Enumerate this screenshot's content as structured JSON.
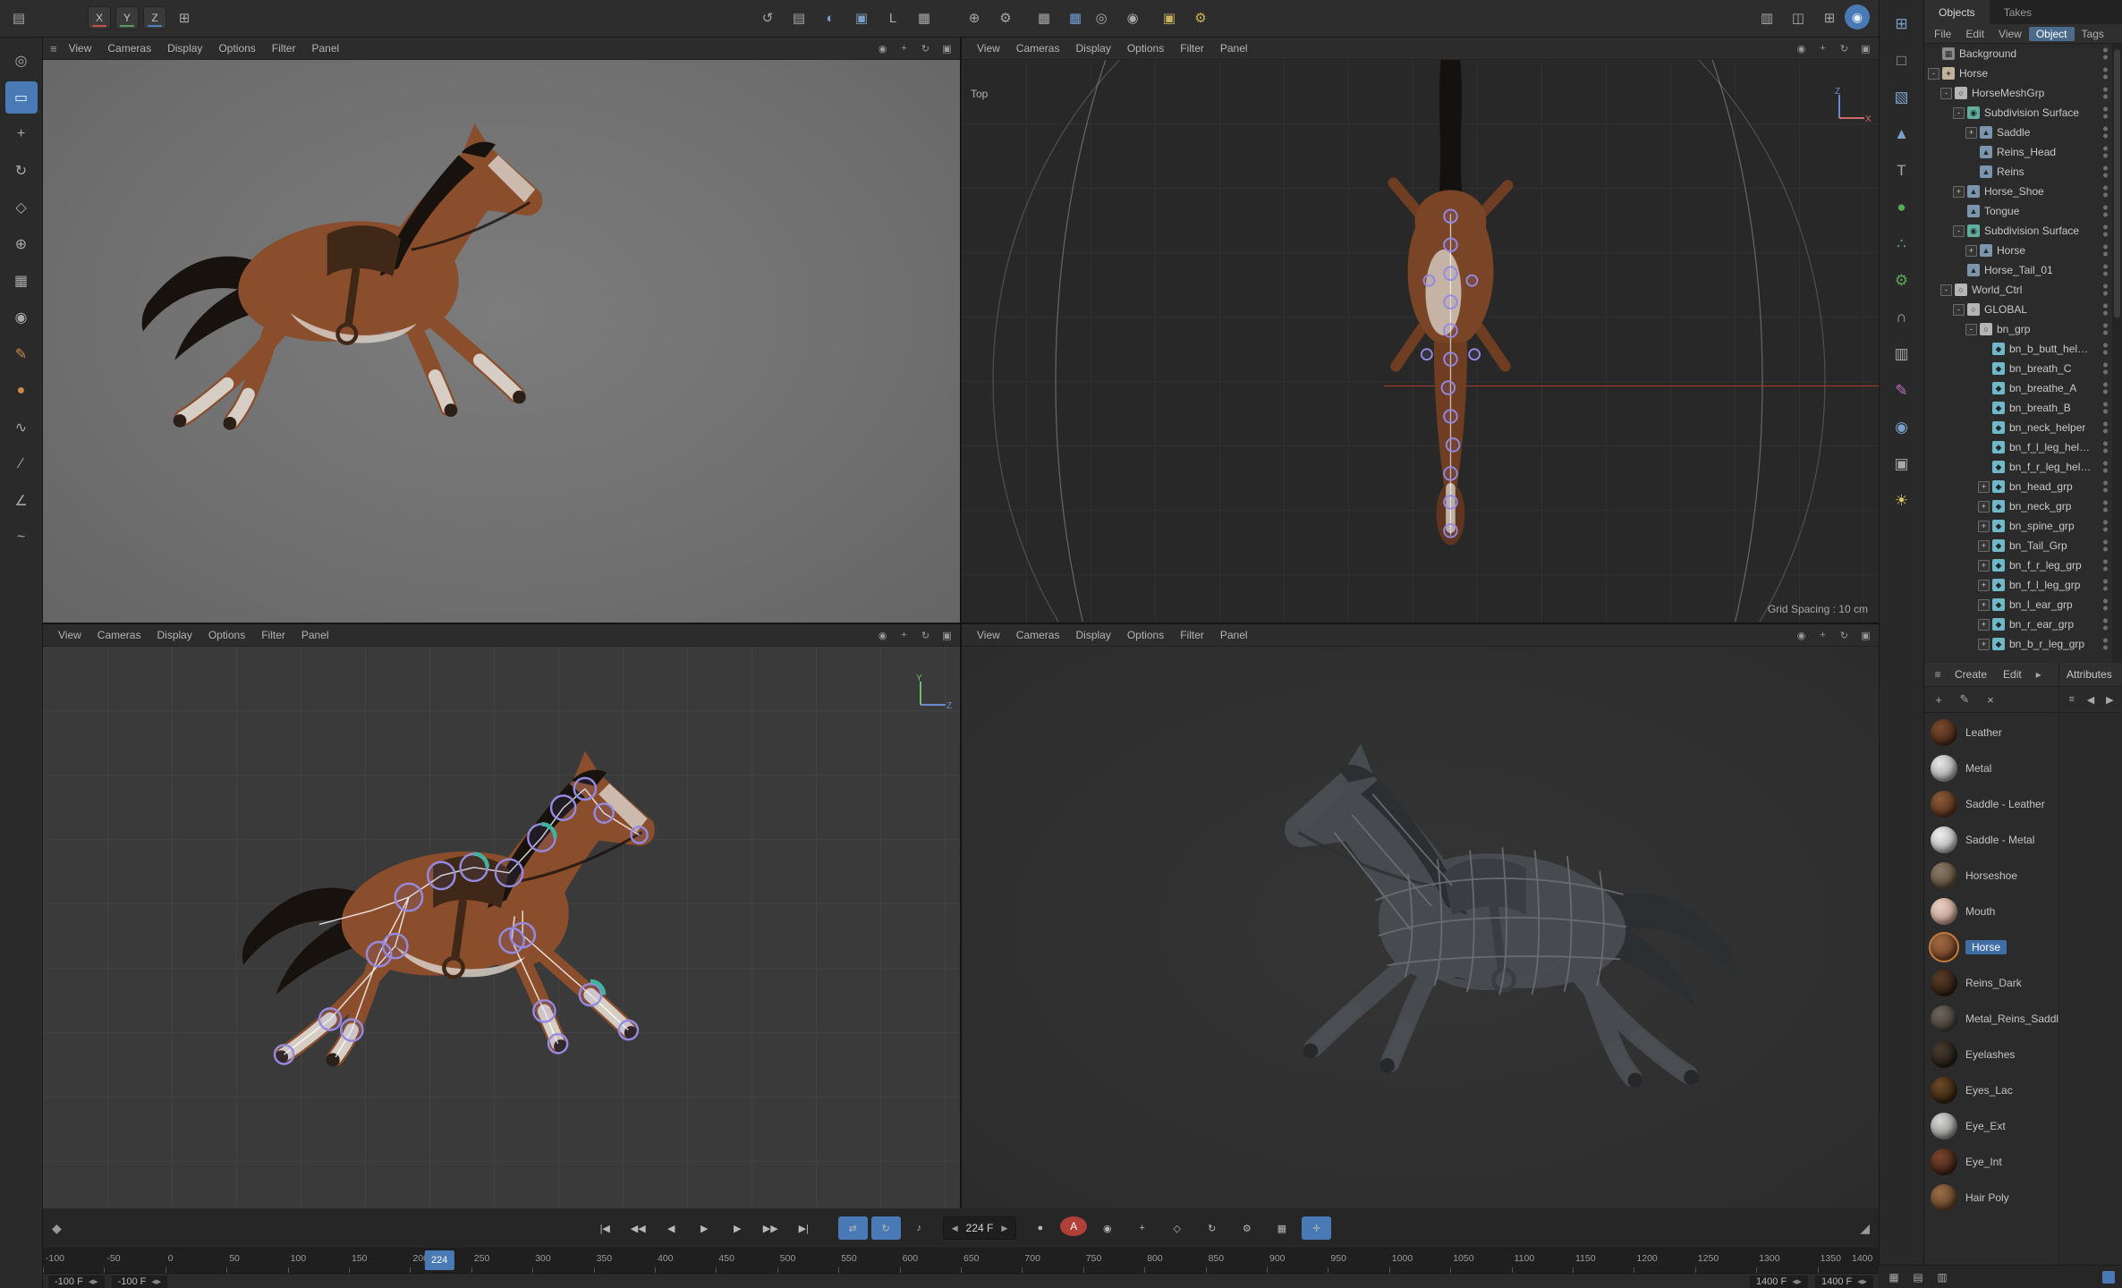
{
  "app": {
    "accent": "#4a7ab5",
    "autokey_red": "#b04038",
    "selection_orange": "#c87b3a"
  },
  "top_toolbar": {
    "groups": {
      "app": [
        {
          "name": "window-icon",
          "glyph": "▤"
        }
      ],
      "axis": [
        {
          "name": "axis-x-button",
          "glyph": "X",
          "underline": "#c05050"
        },
        {
          "name": "axis-y-button",
          "glyph": "Y",
          "underline": "#55a055"
        },
        {
          "name": "axis-z-button",
          "glyph": "Z",
          "underline": "#5080c0"
        },
        {
          "name": "coordinate-system-button",
          "glyph": "⊞"
        }
      ],
      "modes": [
        {
          "name": "history-icon",
          "glyph": "↺"
        },
        {
          "name": "workplane-icon",
          "glyph": "▤"
        },
        {
          "name": "sphere-tool-icon",
          "glyph": "◐",
          "color": "#7aa0c8"
        },
        {
          "name": "cube-tool-icon",
          "glyph": "▣",
          "color": "#7aa0c8"
        },
        {
          "name": "corner-tool-icon",
          "glyph": "L"
        },
        {
          "name": "grid-tool-icon",
          "glyph": "▦"
        }
      ],
      "transform": [
        {
          "name": "move-axis-icon",
          "glyph": "⊕"
        },
        {
          "name": "modeling-settings-icon",
          "glyph": "⚙"
        }
      ],
      "snap": [
        {
          "name": "quantize-icon",
          "glyph": "▦"
        },
        {
          "name": "snap-icon",
          "glyph": "▦",
          "color": "#6f9fd0"
        }
      ],
      "centers": [
        {
          "name": "axis-center-icon",
          "glyph": "◎"
        },
        {
          "name": "workplane-center-icon",
          "glyph": "◉"
        }
      ],
      "render": [
        {
          "name": "render-view-icon",
          "glyph": "▣",
          "color": "#c8b45a"
        },
        {
          "name": "render-settings-icon",
          "glyph": "⚙",
          "color": "#c8b45a"
        }
      ],
      "layouts": [
        {
          "name": "layout-single-icon",
          "glyph": "▥"
        },
        {
          "name": "layout-split-icon",
          "glyph": "◫"
        },
        {
          "name": "layout-quad-icon",
          "glyph": "⊞"
        }
      ],
      "account": [
        {
          "name": "user-avatar",
          "glyph": "◉",
          "color": "#eaf2fb",
          "bg": "#4a7ab5"
        }
      ]
    }
  },
  "left_toolbar": {
    "tools": [
      {
        "name": "zoom-tool",
        "glyph": "◎"
      },
      {
        "name": "selection-tool",
        "glyph": "▭",
        "active": true
      },
      {
        "name": "move-tool",
        "glyph": "+"
      },
      {
        "name": "rotate-tool",
        "glyph": "↻"
      },
      {
        "name": "scale-tool",
        "glyph": "◇"
      },
      {
        "name": "axis-tool",
        "glyph": "⊕"
      },
      {
        "name": "coord-tool",
        "glyph": "▦"
      },
      {
        "name": "magnet-tool",
        "glyph": "◉"
      },
      {
        "name": "brush-tool",
        "glyph": "✎",
        "color": "#c98a4a"
      },
      {
        "name": "paint-tool",
        "glyph": "●",
        "color": "#c98a4a"
      },
      {
        "name": "pen-tool",
        "glyph": "∿"
      },
      {
        "name": "knife-tool",
        "glyph": "∕"
      },
      {
        "name": "measure-tool",
        "glyph": "∠"
      },
      {
        "name": "spline-tool",
        "glyph": "~"
      }
    ]
  },
  "right_strip": {
    "icons": [
      {
        "name": "panels-icon",
        "glyph": "⊞",
        "color": "#7aa0c8"
      },
      {
        "name": "plane-icon",
        "glyph": "□"
      },
      {
        "name": "cube-icon",
        "glyph": "▧",
        "color": "#7aa0c8"
      },
      {
        "name": "pyramid-icon",
        "glyph": "▲",
        "color": "#7aa0c8"
      },
      {
        "name": "text-icon",
        "glyph": "T"
      },
      {
        "name": "sphere-green-icon",
        "glyph": "●",
        "color": "#5aa85a"
      },
      {
        "name": "array-icon",
        "glyph": "∴",
        "color": "#5aa85a"
      },
      {
        "name": "gear-icon",
        "glyph": "⚙",
        "color": "#5aa85a"
      },
      {
        "name": "bend-icon",
        "glyph": "∩"
      },
      {
        "name": "view-panel-icon",
        "glyph": "▥"
      },
      {
        "name": "spline-pen-icon",
        "glyph": "✎",
        "color": "#c470c4"
      },
      {
        "name": "globe-icon",
        "glyph": "◉",
        "color": "#7aa0c8"
      },
      {
        "name": "camera-icon",
        "glyph": "▣"
      },
      {
        "name": "light-icon",
        "glyph": "☀",
        "color": "#d8c86a"
      }
    ]
  },
  "viewports": {
    "menu": [
      "View",
      "Cameras",
      "Display",
      "Options",
      "Filter",
      "Panel"
    ],
    "corner_icons": [
      {
        "name": "camera-move-icon",
        "glyph": "◉"
      },
      {
        "name": "pan-icon",
        "glyph": "+"
      },
      {
        "name": "orbit-icon",
        "glyph": "↻"
      },
      {
        "name": "maximize-icon",
        "glyph": "▣"
      }
    ],
    "top_label": "Top",
    "grid_spacing": "Grid Spacing : 10 cm",
    "gizmo_top": {
      "up": "Z",
      "right": "X"
    },
    "gizmo_side": {
      "up": "Y",
      "right": "Z"
    },
    "burger_glyph": "≡"
  },
  "objects_panel": {
    "tabs": [
      "Objects",
      "Takes"
    ],
    "active_tab": "Objects",
    "menu": [
      "File",
      "Edit",
      "View",
      "Object",
      "Tags"
    ],
    "active_menu": "Object",
    "tree": [
      {
        "label": "Background",
        "depth": 1,
        "expander": "",
        "type": "bg"
      },
      {
        "label": "Horse",
        "depth": 1,
        "expander": "-",
        "type": "ctrl"
      },
      {
        "label": "HorseMeshGrp",
        "depth": 2,
        "expander": "-",
        "type": "null"
      },
      {
        "label": "Subdivision Surface",
        "depth": 3,
        "expander": "-",
        "type": "subd"
      },
      {
        "label": "Saddle",
        "depth": 4,
        "expander": "+",
        "type": "mesh"
      },
      {
        "label": "Reins_Head",
        "depth": 4,
        "expander": "",
        "type": "mesh"
      },
      {
        "label": "Reins",
        "depth": 4,
        "expander": "",
        "type": "mesh"
      },
      {
        "label": "Horse_Shoe",
        "depth": 3,
        "expander": "+",
        "type": "mesh"
      },
      {
        "label": "Tongue",
        "depth": 3,
        "expander": "",
        "type": "mesh"
      },
      {
        "label": "Subdivision Surface",
        "depth": 3,
        "expander": "-",
        "type": "subd"
      },
      {
        "label": "Horse",
        "depth": 4,
        "expander": "+",
        "type": "mesh"
      },
      {
        "label": "Horse_Tail_01",
        "depth": 3,
        "expander": "",
        "type": "mesh"
      },
      {
        "label": "World_Ctrl",
        "depth": 2,
        "expander": "-",
        "type": "null"
      },
      {
        "label": "GLOBAL",
        "depth": 3,
        "expander": "-",
        "type": "null"
      },
      {
        "label": "bn_grp",
        "depth": 4,
        "expander": "-",
        "type": "null"
      },
      {
        "label": "bn_b_butt_helper",
        "depth": 5,
        "expander": "",
        "type": "bone"
      },
      {
        "label": "bn_breath_C",
        "depth": 5,
        "expander": "",
        "type": "bone"
      },
      {
        "label": "bn_breathe_A",
        "depth": 5,
        "expander": "",
        "type": "bone"
      },
      {
        "label": "bn_breath_B",
        "depth": 5,
        "expander": "",
        "type": "bone"
      },
      {
        "label": "bn_neck_helper",
        "depth": 5,
        "expander": "",
        "type": "bone"
      },
      {
        "label": "bn_f_l_leg_helper",
        "depth": 5,
        "expander": "",
        "type": "bone"
      },
      {
        "label": "bn_f_r_leg_helper",
        "depth": 5,
        "expander": "",
        "type": "bone"
      },
      {
        "label": "bn_head_grp",
        "depth": 5,
        "expander": "+",
        "type": "bone"
      },
      {
        "label": "bn_neck_grp",
        "depth": 5,
        "expander": "+",
        "type": "bone"
      },
      {
        "label": "bn_spine_grp",
        "depth": 5,
        "expander": "+",
        "type": "bone"
      },
      {
        "label": "bn_Tail_Grp",
        "depth": 5,
        "expander": "+",
        "type": "bone"
      },
      {
        "label": "bn_f_r_leg_grp",
        "depth": 5,
        "expander": "+",
        "type": "bone"
      },
      {
        "label": "bn_f_l_leg_grp",
        "depth": 5,
        "expander": "+",
        "type": "bone"
      },
      {
        "label": "bn_l_ear_grp",
        "depth": 5,
        "expander": "+",
        "type": "bone"
      },
      {
        "label": "bn_r_ear_grp",
        "depth": 5,
        "expander": "+",
        "type": "bone"
      },
      {
        "label": "bn_b_r_leg_grp",
        "depth": 5,
        "expander": "+",
        "type": "bone"
      }
    ]
  },
  "materials_panel": {
    "menu": [
      "Create",
      "Edit"
    ],
    "menu_overflow_glyph": "▸",
    "attributes_tab": "Attributes",
    "toolbar_icons": [
      {
        "name": "add-material-button",
        "glyph": "+"
      },
      {
        "name": "edit-material-button",
        "glyph": "✎"
      },
      {
        "name": "delete-material-button",
        "glyph": "×"
      }
    ],
    "attr_toolbar_icons": [
      {
        "name": "attr-menu-icon",
        "glyph": "≡"
      },
      {
        "name": "attr-back-icon",
        "glyph": "◀"
      },
      {
        "name": "attr-forward-icon",
        "glyph": "▶"
      }
    ],
    "selected": "Horse",
    "materials": [
      {
        "name": "Leather",
        "color": "#452718",
        "hi": "#7a4a2e"
      },
      {
        "name": "Metal",
        "color": "#9a9a9a",
        "hi": "#e8e8e8"
      },
      {
        "name": "Saddle - Leather",
        "color": "#54301c",
        "hi": "#8a5a36"
      },
      {
        "name": "Saddle - Metal",
        "color": "#a8a8a8",
        "hi": "#f0f0f0"
      },
      {
        "name": "Horseshoe",
        "color": "#5a4a3a",
        "hi": "#8a7a66"
      },
      {
        "name": "Mouth",
        "color": "#b89484",
        "hi": "#e8d0c4"
      },
      {
        "name": "Horse",
        "color": "#6e3f24",
        "hi": "#a06a42",
        "selected": true
      },
      {
        "name": "Reins_Dark",
        "color": "#2c1c12",
        "hi": "#5a3c26"
      },
      {
        "name": "Metal_Reins_Saddle",
        "color": "#3e3832",
        "hi": "#6e665c"
      },
      {
        "name": "Eyelashes",
        "color": "#201a14",
        "hi": "#4a3c2e"
      },
      {
        "name": "Eyes_Lac",
        "color": "#32200f",
        "hi": "#6a4a26"
      },
      {
        "name": "Eye_Ext",
        "color": "#8a8a88",
        "hi": "#d8d8d4"
      },
      {
        "name": "Eye_Int",
        "color": "#3c2014",
        "hi": "#7a4630"
      },
      {
        "name": "Hair Poly",
        "color": "#5c3e26",
        "hi": "#9a6e46"
      }
    ]
  },
  "timeline": {
    "marker_icon": "◆",
    "buttons": [
      {
        "name": "goto-start-button",
        "glyph": "|◀"
      },
      {
        "name": "prev-key-button",
        "glyph": "◀◀"
      },
      {
        "name": "prev-frame-button",
        "glyph": "◀"
      },
      {
        "name": "play-button",
        "glyph": "▶"
      },
      {
        "name": "next-frame-button",
        "glyph": "▶"
      },
      {
        "name": "next-key-button",
        "glyph": "▶▶"
      },
      {
        "name": "goto-end-button",
        "glyph": "▶|"
      }
    ],
    "toggles": [
      {
        "name": "loop-toggle",
        "glyph": "⇄",
        "active": true
      },
      {
        "name": "pingpong-toggle",
        "glyph": "↻",
        "active": true
      },
      {
        "name": "sound-toggle",
        "glyph": "♪"
      }
    ],
    "frame_field": {
      "value": "224 F",
      "dec": "◀",
      "inc": "▶"
    },
    "record_buttons": [
      {
        "name": "record-button",
        "glyph": "●"
      },
      {
        "name": "autokey-button",
        "glyph": "A",
        "red": true
      },
      {
        "name": "keyframe-selection-button",
        "glyph": "◉"
      },
      {
        "name": "key-position-toggle",
        "glyph": "+"
      },
      {
        "name": "key-scale-toggle",
        "glyph": "◇"
      },
      {
        "name": "key-rotation-toggle",
        "glyph": "↻"
      },
      {
        "name": "key-parameter-toggle",
        "glyph": "⚙"
      },
      {
        "name": "key-pla-toggle",
        "glyph": "▦"
      },
      {
        "name": "snap-frame-toggle",
        "glyph": "✛",
        "active": true
      }
    ],
    "playhead": {
      "label": "224",
      "frame": 224
    },
    "ruler": {
      "start": -100,
      "end": 1400,
      "step": 50
    },
    "range": {
      "start_a": "-100 F",
      "start_b": "-100 F",
      "end_a": "1400 F",
      "end_b": "1400 F"
    },
    "resize_icon": "◢"
  },
  "right_bottom_bar": {
    "icons": [
      {
        "name": "grid-view-icon",
        "glyph": "▦"
      },
      {
        "name": "list-view-icon",
        "glyph": "▤"
      },
      {
        "name": "column-view-icon",
        "glyph": "▥"
      }
    ]
  }
}
